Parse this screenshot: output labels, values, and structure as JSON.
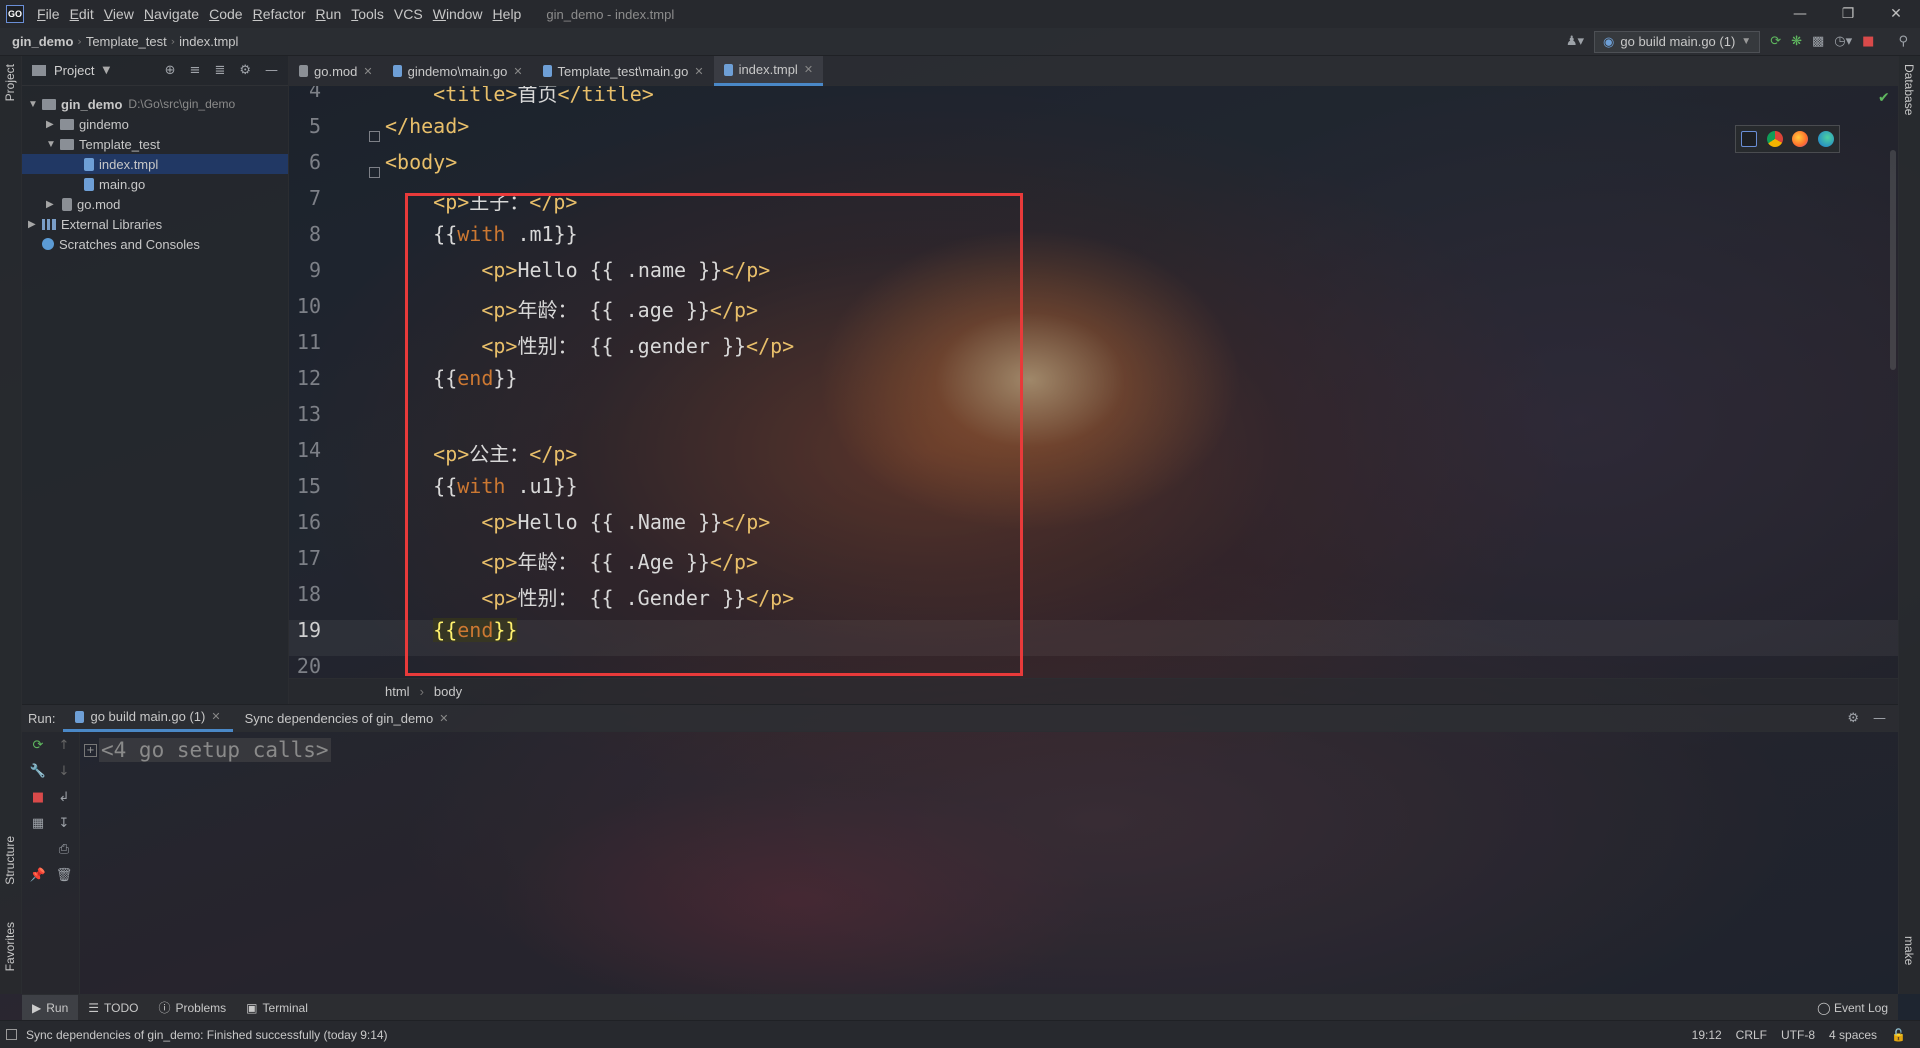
{
  "app": {
    "logo": "GO",
    "window_title": "gin_demo - index.tmpl"
  },
  "menu": [
    {
      "label": "File",
      "mnemonic": "F",
      "rest": "ile"
    },
    {
      "label": "Edit",
      "mnemonic": "E",
      "rest": "dit"
    },
    {
      "label": "View",
      "mnemonic": "V",
      "rest": "iew"
    },
    {
      "label": "Navigate",
      "mnemonic": "N",
      "rest": "avigate"
    },
    {
      "label": "Code",
      "mnemonic": "C",
      "rest": "ode"
    },
    {
      "label": "Refactor",
      "mnemonic": "R",
      "rest": "efactor"
    },
    {
      "label": "Run",
      "mnemonic": "R",
      "rest": "un"
    },
    {
      "label": "Tools",
      "mnemonic": "T",
      "rest": "ools"
    },
    {
      "label": "VCS",
      "mnemonic": "",
      "rest": "VCS"
    },
    {
      "label": "Window",
      "mnemonic": "W",
      "rest": "indow"
    },
    {
      "label": "Help",
      "mnemonic": "H",
      "rest": "elp"
    }
  ],
  "nav": {
    "crumbs": [
      "gin_demo",
      "Template_test",
      "index.tmpl"
    ],
    "run_config": "go build main.go (1)"
  },
  "sidebar": {
    "project_label": "Project",
    "structure_label": "Structure",
    "favorites_label": "Favorites"
  },
  "right_sidebar": {
    "database_label": "Database",
    "make_label": "make"
  },
  "tree": [
    {
      "name": "gin_demo",
      "path": "D:\\Go\\src\\gin_demo"
    },
    {
      "name": "gindemo"
    },
    {
      "name": "Template_test"
    },
    {
      "name": "index.tmpl"
    },
    {
      "name": "main.go"
    },
    {
      "name": "go.mod"
    },
    {
      "name": "External Libraries"
    },
    {
      "name": "Scratches and Consoles"
    }
  ],
  "tabs": [
    {
      "label": "go.mod"
    },
    {
      "label": "gindemo\\main.go"
    },
    {
      "label": "Template_test\\main.go"
    },
    {
      "label": "index.tmpl"
    }
  ],
  "editor": {
    "line_numbers": [
      "4",
      "5",
      "6",
      "7",
      "8",
      "9",
      "10",
      "11",
      "12",
      "13",
      "14",
      "15",
      "16",
      "17",
      "18",
      "19",
      "20"
    ],
    "lines": {
      "l4": {
        "indent": "    ",
        "a": "<title>",
        "b": "首页",
        "c": "</title>"
      },
      "l5": {
        "a": "</head>"
      },
      "l6": {
        "a": "<body>"
      },
      "l7": {
        "indent": "    ",
        "a": "<p>",
        "b": "王子：",
        "c": "</p>"
      },
      "l8": {
        "indent": "    ",
        "a": "{{",
        "kw": "with",
        "b": " .m1}}"
      },
      "l9": {
        "indent": "        ",
        "a": "<p>",
        "b": "Hello {{ .name }}",
        "c": "</p>"
      },
      "l10": {
        "indent": "        ",
        "a": "<p>",
        "b": "年龄： {{ .age }}",
        "c": "</p>"
      },
      "l11": {
        "indent": "        ",
        "a": "<p>",
        "b": "性别： {{ .gender }}",
        "c": "</p>"
      },
      "l12": {
        "indent": "    ",
        "a": "{{",
        "kw": "end",
        "b": "}}"
      },
      "l14": {
        "indent": "    ",
        "a": "<p>",
        "b": "公主：",
        "c": "</p>"
      },
      "l15": {
        "indent": "    ",
        "a": "{{",
        "kw": "with",
        "b": " .u1}}"
      },
      "l16": {
        "indent": "        ",
        "a": "<p>",
        "b": "Hello {{ .Name }}",
        "c": "</p>"
      },
      "l17": {
        "indent": "        ",
        "a": "<p>",
        "b": "年龄： {{ .Age }}",
        "c": "</p>"
      },
      "l18": {
        "indent": "        ",
        "a": "<p>",
        "b": "性别： {{ .Gender }}",
        "c": "</p>"
      },
      "l19": {
        "indent": "    ",
        "a": "{{",
        "kw": "end",
        "b": "}}"
      }
    },
    "code_crumbs": [
      "html",
      "body"
    ]
  },
  "run_panel": {
    "label": "Run:",
    "tabs": [
      "go build main.go (1)",
      "Sync dependencies of gin_demo"
    ],
    "console_line": "<4 go setup calls>",
    "expand_glyph": "+"
  },
  "tool_windows": [
    "Run",
    "TODO",
    "Problems",
    "Terminal"
  ],
  "event_log": "Event Log",
  "status": {
    "message": "Sync dependencies of gin_demo: Finished successfully (today 9:14)",
    "position": "19:12",
    "line_sep": "CRLF",
    "encoding": "UTF-8",
    "indent": "4 spaces"
  },
  "icons": [
    "close-icon",
    "minimize-icon",
    "restore-icon",
    "run-icon",
    "debug-icon",
    "stop-icon",
    "search-icon",
    "gear-icon",
    "settings-icon",
    "chrome-icon",
    "firefox-icon",
    "edge-icon",
    "goland-icon"
  ],
  "colors": {
    "accent": "#4a88c7",
    "highlight_box": "#e83a3a",
    "tag": "#e8bf6a",
    "keyword": "#cc7832"
  }
}
